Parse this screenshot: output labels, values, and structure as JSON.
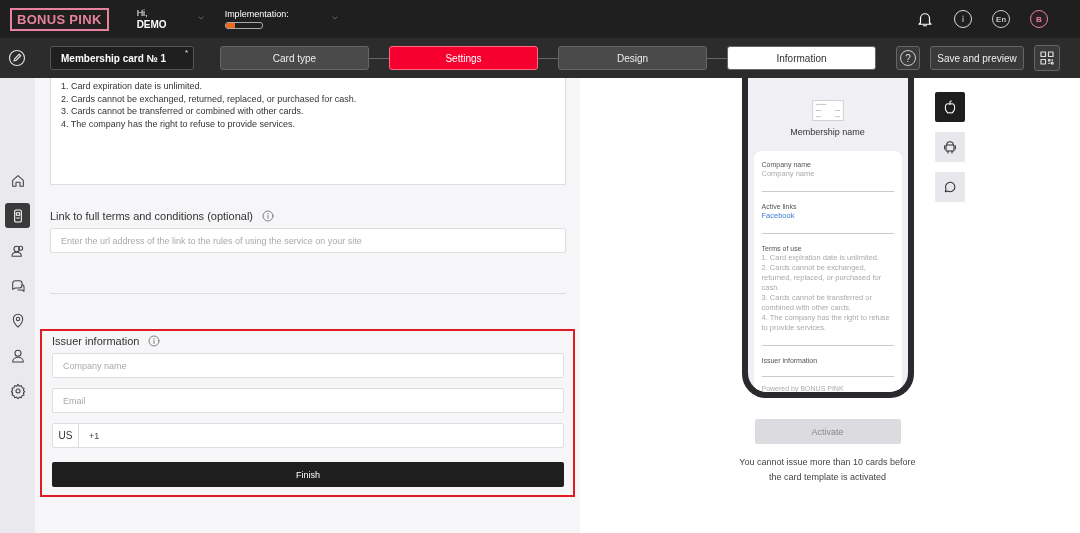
{
  "header": {
    "logo": "BONUS PINK",
    "greeting": "Hi,",
    "user": "DEMO",
    "implementation_label": "Implementation:",
    "implementation": {
      "level": 0.25
    },
    "language": "En",
    "avatar": "B"
  },
  "toolbar": {
    "card_name": "Membership card № 1",
    "required_mark": "*",
    "steps": [
      {
        "label": "Card type",
        "selected": false,
        "kind": "dark"
      },
      {
        "label": "Settings",
        "selected": true,
        "kind": "dark"
      },
      {
        "label": "Design",
        "selected": false,
        "kind": "dark"
      },
      {
        "label": "Information",
        "selected": false,
        "kind": "light"
      }
    ],
    "help": "?",
    "save_button": "Save and preview"
  },
  "sidebar": {
    "items": [
      {
        "kind": "home",
        "selected": false
      },
      {
        "kind": "card",
        "selected": true
      },
      {
        "kind": "users",
        "selected": false
      },
      {
        "kind": "chat",
        "selected": false
      },
      {
        "kind": "pin",
        "selected": false
      },
      {
        "kind": "user",
        "selected": false
      },
      {
        "kind": "gear",
        "selected": false
      }
    ]
  },
  "form": {
    "terms_lines": [
      "1. Card expiration date is unlimited.",
      "2. Cards cannot be exchanged, returned, replaced, or purchased for cash.",
      "3. Cards cannot be transferred or combined with other cards.",
      "4. The company has the right to refuse to provide services."
    ],
    "link_label": "Link to full terms and conditions (optional)",
    "link_placeholder": "Enter the url address of the link to the rules of using the service on your site",
    "issuer": {
      "highlighted": true,
      "label": "Issuer information",
      "company_placeholder": "Company name",
      "email_placeholder": "Email",
      "country": "US",
      "phone_value": "+1",
      "finish": "Finish"
    }
  },
  "preview": {
    "membership_name": "Membership name",
    "sections": [
      {
        "label": "Company name",
        "kind": "muted",
        "lines": [
          "Company name"
        ]
      },
      {
        "label": "Active links",
        "kind": "link",
        "lines": [
          "Facebook"
        ]
      },
      {
        "label": "Terms of use",
        "kind": "muted",
        "lines": [
          "1. Card expiration date is unlimited.",
          "2. Cards cannot be exchanged, returned, replaced, or purchased for cash.",
          "3. Cards cannot be transferred or combined with other cards.",
          "4. The company has the right to refuse to provide services."
        ]
      },
      {
        "label": "Issuer information"
      }
    ],
    "footer": "Powered by BONUS PINK",
    "activate": {
      "label": "Activate",
      "disabled": true
    },
    "note": "You cannot issue more than 10 cards before the card template is activated",
    "platforms": [
      {
        "kind": "apple",
        "selected": true
      },
      {
        "kind": "android",
        "selected": false
      },
      {
        "kind": "chat",
        "selected": false
      }
    ]
  }
}
